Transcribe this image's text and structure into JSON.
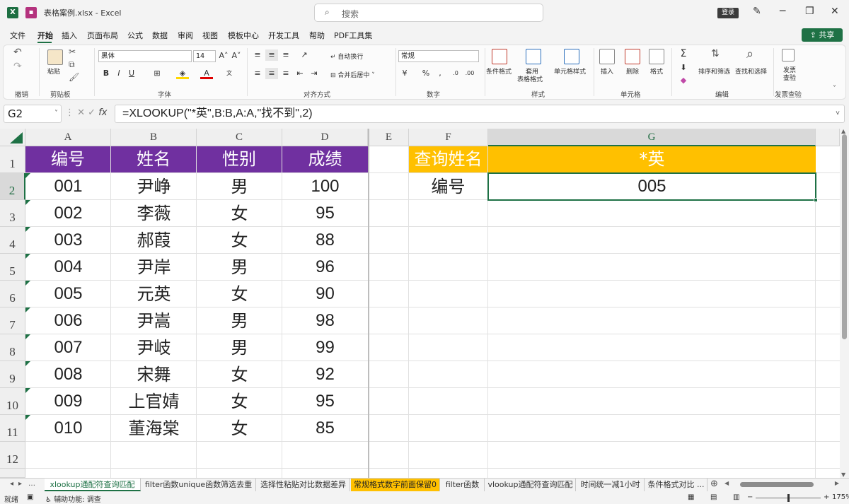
{
  "window": {
    "file_name": "表格案例.xlsx  -  Excel",
    "search_placeholder": "搜索",
    "login_label": "登录",
    "share_label": "共享"
  },
  "menu": [
    "文件",
    "开始",
    "插入",
    "页面布局",
    "公式",
    "数据",
    "审阅",
    "视图",
    "模板中心",
    "开发工具",
    "帮助",
    "PDF工具集"
  ],
  "ribbon": {
    "undo_group": "撤销",
    "clipboard_group": "剪贴板",
    "paste_label": "粘贴",
    "font_group": "字体",
    "font_name": "黑体",
    "font_size": "14",
    "align_group": "对齐方式",
    "wrap_text": "自动换行",
    "merge_center": "合并后居中",
    "number_group": "数字",
    "number_format": "常规",
    "styles_group": "样式",
    "cond_format": "条件格式",
    "table_format": "套用\n表格格式",
    "table_format_l1": "套用",
    "table_format_l2": "表格格式",
    "cell_styles": "单元格样式",
    "cells_group": "单元格",
    "insert": "插入",
    "delete": "删除",
    "format": "格式",
    "editing_group": "编辑",
    "sort_filter": "排序和筛选",
    "find_select": "查找和选择",
    "invoice_l1": "发票",
    "invoice_l2": "查验",
    "invoice_group": "发票查验"
  },
  "formula_bar": {
    "name_box": "G2",
    "formula": "=XLOOKUP(\"*英\",B:B,A:A,\"找不到\",2)"
  },
  "columns": [
    "A",
    "B",
    "C",
    "D",
    "E",
    "F",
    "G"
  ],
  "rows": [
    "1",
    "2",
    "3",
    "4",
    "5",
    "6",
    "7",
    "8",
    "9",
    "10",
    "11",
    "12"
  ],
  "table": {
    "headers": [
      "编号",
      "姓名",
      "性别",
      "成绩"
    ],
    "rows": [
      [
        "001",
        "尹峥",
        "男",
        "100"
      ],
      [
        "002",
        "李薇",
        "女",
        "95"
      ],
      [
        "003",
        "郝葭",
        "女",
        "88"
      ],
      [
        "004",
        "尹岸",
        "男",
        "96"
      ],
      [
        "005",
        "元英",
        "女",
        "90"
      ],
      [
        "006",
        "尹嵩",
        "男",
        "98"
      ],
      [
        "007",
        "尹岐",
        "男",
        "99"
      ],
      [
        "008",
        "宋舞",
        "女",
        "92"
      ],
      [
        "009",
        "上官婧",
        "女",
        "95"
      ],
      [
        "010",
        "董海棠",
        "女",
        "85"
      ]
    ]
  },
  "lookup": {
    "query_label": "查询姓名",
    "query_value": "*英",
    "result_label": "编号",
    "result_value": "005"
  },
  "sheet_tabs": [
    "xlookup通配符查询匹配",
    "filter函数unique函数筛选去重",
    "选择性粘贴对比数据差异",
    "常规格式数字前面保留0",
    "filter函数",
    "vlookup通配符查询匹配",
    "时间统一减1小时",
    "条件格式对比 ..."
  ],
  "status": {
    "ready": "就绪",
    "accessibility": "辅助功能: 调查",
    "zoom": "175%"
  },
  "colors": {
    "header_purple": "#7030a0",
    "highlight_yellow": "#ffc000",
    "excel_green": "#1e7145"
  }
}
